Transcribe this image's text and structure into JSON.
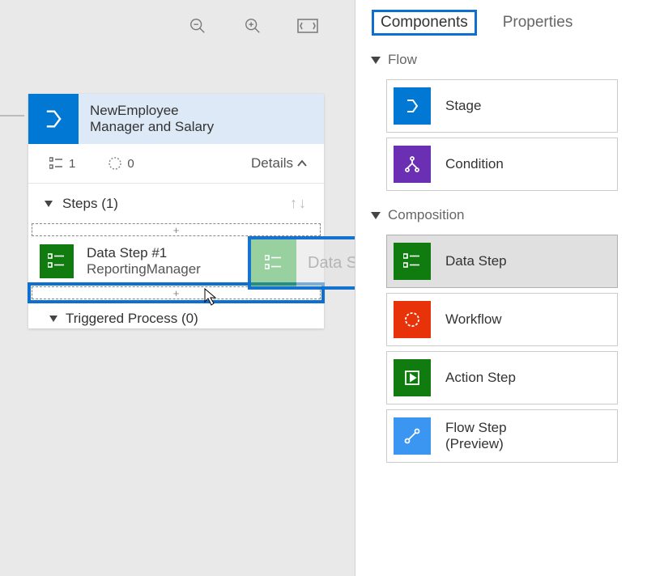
{
  "toolbar": {
    "zoom_out": "zoom-out",
    "zoom_in": "zoom-in",
    "fit": "fit-screen"
  },
  "stage": {
    "title_line1": "NewEmployee",
    "title_line2": "Manager and Salary",
    "meta_count1": "1",
    "meta_count2": "0",
    "details_label": "Details",
    "steps_label": "Steps (1)",
    "step1_title": "Data Step #1",
    "step1_sub": "ReportingManager",
    "triggered_label": "Triggered Process (0)"
  },
  "drag": {
    "ghost_label": "Data Step"
  },
  "sidebar": {
    "tabs": {
      "components": "Components",
      "properties": "Properties"
    },
    "sections": {
      "flow": "Flow",
      "composition": "Composition"
    },
    "components": {
      "stage": "Stage",
      "condition": "Condition",
      "data_step": "Data Step",
      "workflow": "Workflow",
      "action_step": "Action Step",
      "flow_step_line1": "Flow Step",
      "flow_step_line2": "(Preview)"
    }
  }
}
